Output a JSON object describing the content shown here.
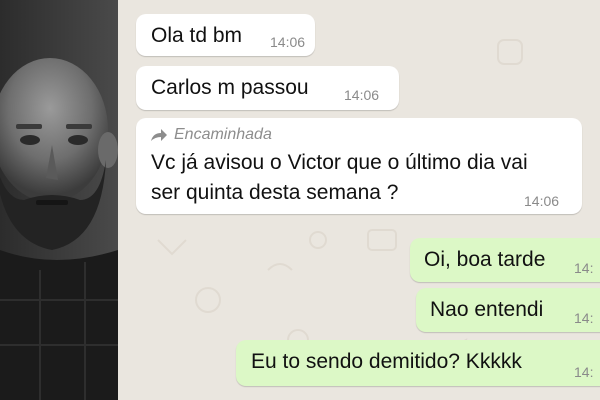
{
  "messages": [
    {
      "text": "Ola td bm",
      "time": "14:06",
      "direction": "incoming"
    },
    {
      "text": "Carlos m passou",
      "time": "14:06",
      "direction": "incoming"
    },
    {
      "forwarded_label": "Encaminhada",
      "lines": [
        "Vc já avisou o Victor que o último dia vai",
        "ser quinta desta semana ?"
      ],
      "time": "14:06",
      "direction": "incoming"
    },
    {
      "text": "Oi, boa tarde",
      "time": "14:",
      "direction": "outgoing"
    },
    {
      "text": "Nao entendi",
      "time": "14:",
      "direction": "outgoing"
    },
    {
      "text": "Eu to sendo demitido? Kkkkk",
      "time": "14:",
      "direction": "outgoing"
    }
  ],
  "colors": {
    "incoming_bubble": "#ffffff",
    "outgoing_bubble": "#dcf8c6",
    "chat_background": "#eae6df",
    "timestamp": "#8a8a8a"
  },
  "icons": {
    "forwarded": "forward-arrow-icon"
  }
}
